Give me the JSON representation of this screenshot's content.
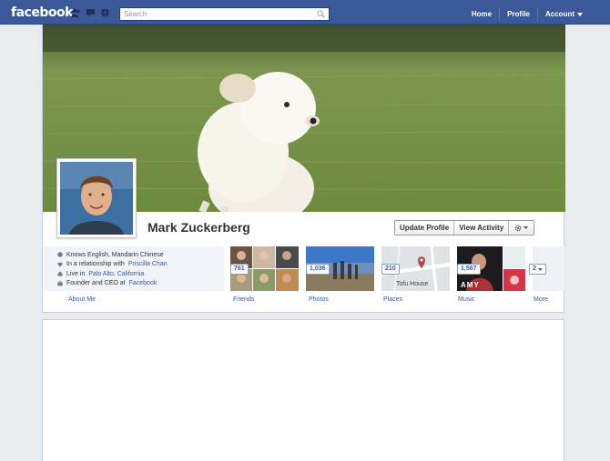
{
  "topbar": {
    "logo": "facebook",
    "search_placeholder": "Search",
    "nav": {
      "home": "Home",
      "profile": "Profile",
      "account": "Account"
    }
  },
  "profile": {
    "name": "Mark Zuckerberg",
    "actions": {
      "update": "Update Profile",
      "activity": "View Activity"
    },
    "info": [
      {
        "text": "Knows English, Mandarin Chinese",
        "link": ""
      },
      {
        "text": "In a relationship with ",
        "link": "Priscilla Chan"
      },
      {
        "text": "Live in ",
        "link": "Palo Alto, California"
      },
      {
        "text": "Founder and CEO at ",
        "link": "Facebook"
      }
    ],
    "tiles": {
      "friends": {
        "count": "761",
        "label": "Friends"
      },
      "photos": {
        "count": "1,036",
        "label": "Photos"
      },
      "places": {
        "count": "210",
        "label": "Places",
        "map_label": "Tofu House"
      },
      "music": {
        "count": "1,567",
        "label": "Music",
        "album_text": "AMY"
      },
      "more": {
        "count": "2",
        "label": "More"
      }
    },
    "about_label": "About Me"
  },
  "colors": {
    "brand": "#3b5998",
    "link": "#3b5998",
    "background": "#e9ebee"
  }
}
